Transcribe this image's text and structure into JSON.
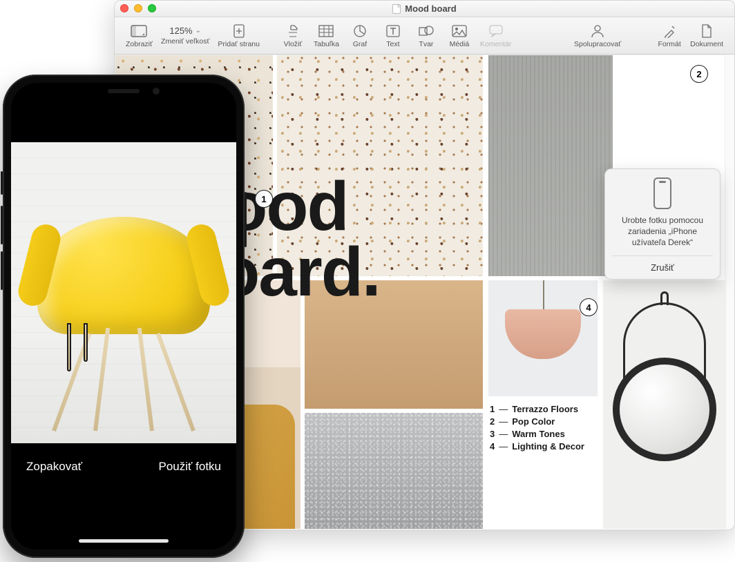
{
  "window": {
    "title": "Mood board",
    "zoom": "125%"
  },
  "toolbar": {
    "view": "Zobraziť",
    "zoom_label": "Zmeniť veľkosť",
    "add_page": "Pridať stranu",
    "insert": "Vložiť",
    "table": "Tabuľka",
    "chart": "Graf",
    "text": "Text",
    "shape": "Tvar",
    "media": "Médiá",
    "comment": "Komentár",
    "collaborate": "Spolupracovať",
    "format": "Formát",
    "document": "Dokument"
  },
  "document": {
    "heading_line1": "Mood",
    "heading_line2": "Board.",
    "callouts": {
      "c1": "1",
      "c2": "2",
      "c4": "4"
    },
    "legend": [
      {
        "n": "1",
        "text": "Terrazzo Floors"
      },
      {
        "n": "2",
        "text": "Pop Color"
      },
      {
        "n": "3",
        "text": "Warm Tones"
      },
      {
        "n": "4",
        "text": "Lighting & Decor"
      }
    ]
  },
  "popover": {
    "message": "Urobte fotku pomocou zariadenia „iPhone užívateľa Derek“",
    "cancel": "Zrušiť"
  },
  "iphone": {
    "retake": "Zopakovať",
    "use_photo": "Použiť fotku"
  }
}
